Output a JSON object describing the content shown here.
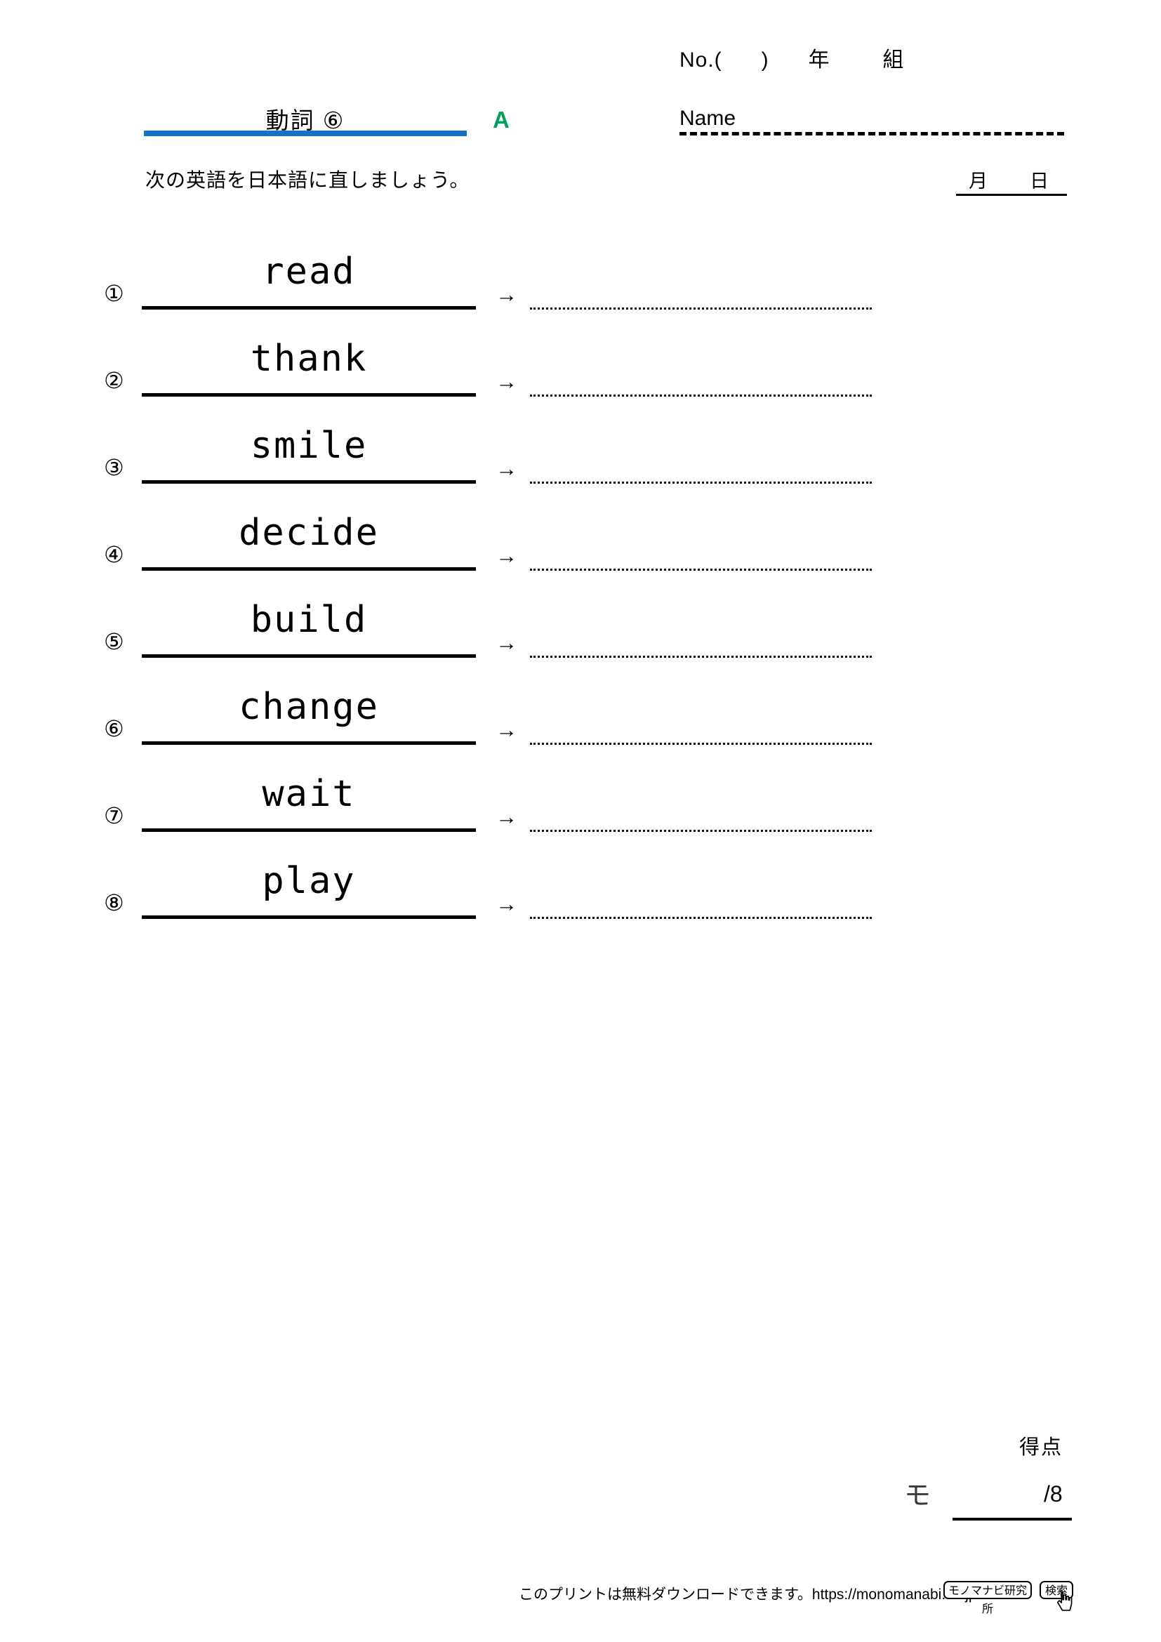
{
  "header": {
    "number_field": "No.(      )      年        組",
    "name_label": "Name",
    "date_label": "月        日"
  },
  "title": {
    "text": "動詞 ⑥",
    "marker": "A",
    "bar_color": "#1373c0",
    "marker_color": "#00a05a"
  },
  "instruction": "次の英語を日本語に直しましょう。",
  "questions": [
    {
      "num": "①",
      "word": "read",
      "arrow": "→",
      "answer": ""
    },
    {
      "num": "②",
      "word": "thank",
      "arrow": "→",
      "answer": ""
    },
    {
      "num": "③",
      "word": "smile",
      "arrow": "→",
      "answer": ""
    },
    {
      "num": "④",
      "word": "decide",
      "arrow": "→",
      "answer": ""
    },
    {
      "num": "⑤",
      "word": "build",
      "arrow": "→",
      "answer": ""
    },
    {
      "num": "⑥",
      "word": "change",
      "arrow": "→",
      "answer": ""
    },
    {
      "num": "⑦",
      "word": "wait",
      "arrow": "→",
      "answer": ""
    },
    {
      "num": "⑧",
      "word": "play",
      "arrow": "→",
      "answer": ""
    }
  ],
  "score": {
    "label": "得点",
    "kanji": "モ",
    "max": "/8"
  },
  "footer": {
    "text": "このプリントは無料ダウンロードできます。https://monomanabi.co.jp",
    "search_value": "モノマナビ研究所",
    "search_button": "検索",
    "cursor_icon": "hand-pointer-icon"
  }
}
